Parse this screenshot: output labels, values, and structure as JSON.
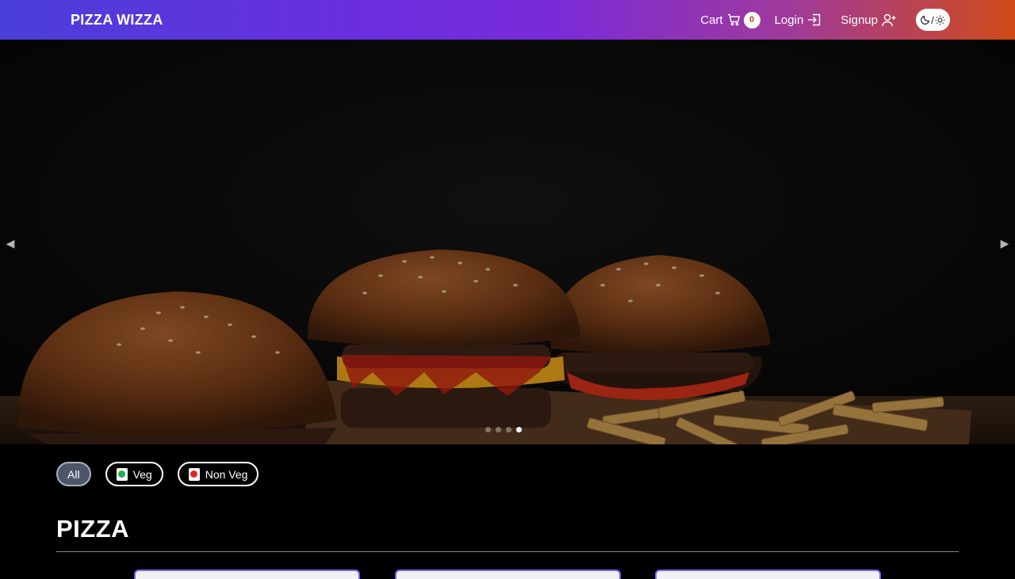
{
  "navbar": {
    "brand": "PIZZA WIZZA",
    "cart_label": "Cart",
    "cart_count": "0",
    "login_label": "Login",
    "signup_label": "Signup",
    "theme_toggle_separator": "/",
    "cart_icon": "cart-icon",
    "login_icon": "login-icon",
    "signup_icon": "user-plus-icon",
    "theme_icons": [
      "moon-icon",
      "sun-icon"
    ]
  },
  "carousel": {
    "slide_image": "burgers-and-fries",
    "slides_count": 4,
    "active_slide": 4
  },
  "filters": {
    "items": [
      {
        "label": "All",
        "active": true
      },
      {
        "label": "Veg",
        "indicator_color": "#22b14c",
        "active": false
      },
      {
        "label": "Non Veg",
        "indicator_color": "#e02424",
        "active": false
      }
    ]
  },
  "section": {
    "title": "PIZZA"
  },
  "colors": {
    "nav_gradient_start": "#4a3fd8",
    "nav_gradient_end": "#cf4b18",
    "background": "#000000",
    "card_border": "#7a5cff"
  }
}
